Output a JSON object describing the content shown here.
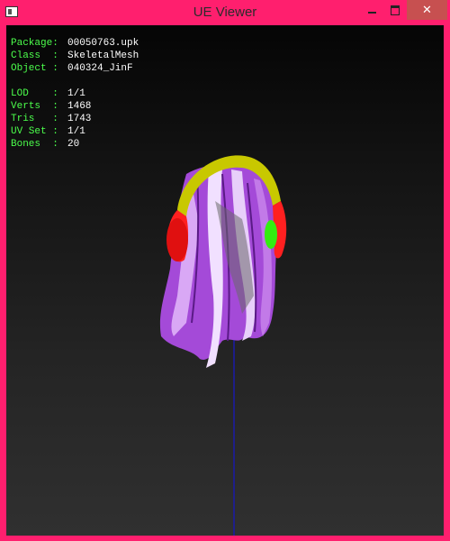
{
  "window": {
    "title": "UE Viewer",
    "minimize_icon": "minimize-icon",
    "maximize_icon": "maximize-icon",
    "close_label": "✕"
  },
  "info": {
    "package": {
      "label": "Package:",
      "value": "00050763.upk"
    },
    "class": {
      "label": "Class  :",
      "value": "SkeletalMesh"
    },
    "object": {
      "label": "Object :",
      "value": "040324_JinF"
    },
    "lod": {
      "label": "LOD    :",
      "value": "1/1"
    },
    "verts": {
      "label": "Verts  :",
      "value": "1468"
    },
    "tris": {
      "label": "Tris   :",
      "value": "1743"
    },
    "uvset": {
      "label": "UV Set :",
      "value": "1/1"
    },
    "bones": {
      "label": "Bones  :",
      "value": "20"
    }
  },
  "colors": {
    "frame": "#ff1f6e",
    "info_label": "#4cff4c",
    "info_value": "#ffffff",
    "hair": "#a44ad8",
    "headphone_band": "#c8c800",
    "headphone_left": "#ff2020",
    "headphone_right": "#33ee11",
    "axis": "#1a1aa8"
  }
}
